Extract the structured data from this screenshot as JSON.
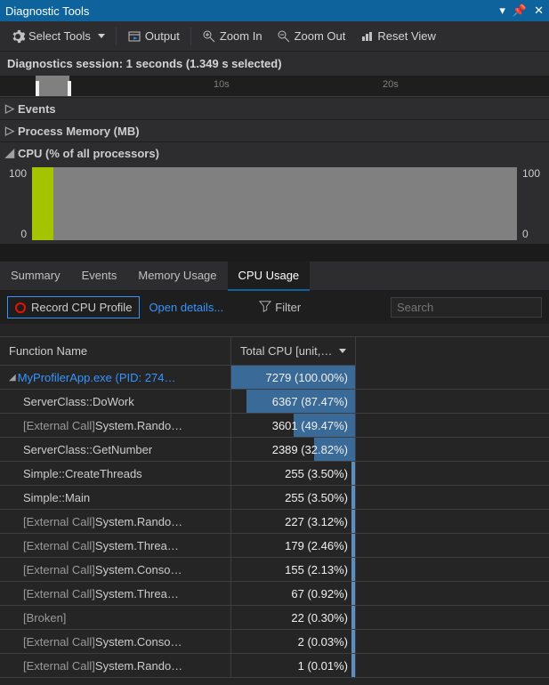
{
  "title": "Diagnostic Tools",
  "toolbar": {
    "select_tools": "Select Tools",
    "output": "Output",
    "zoom_in": "Zoom In",
    "zoom_out": "Zoom Out",
    "reset_view": "Reset View"
  },
  "session_info": "Diagnostics session: 1 seconds (1.349 s selected)",
  "timeline": {
    "ticks": [
      "10s",
      "20s"
    ]
  },
  "sections": {
    "events": "Events",
    "process_memory": "Process Memory (MB)",
    "cpu_header": "CPU (% of all processors)"
  },
  "chart_data": {
    "type": "area",
    "title": "CPU (% of all processors)",
    "xlabel": "",
    "ylabel": "",
    "ylim": [
      0,
      100
    ],
    "ylabels_left": [
      "100",
      "0"
    ],
    "ylabels_right": [
      "100",
      "0"
    ]
  },
  "tabs": [
    "Summary",
    "Events",
    "Memory Usage",
    "CPU Usage"
  ],
  "active_tab": 3,
  "cpu_toolbar": {
    "record": "Record CPU Profile",
    "open_details": "Open details...",
    "filter": "Filter",
    "search_placeholder": "Search"
  },
  "columns": {
    "fn": "Function Name",
    "cpu": "Total CPU [unit,…"
  },
  "rows": [
    {
      "name": "MyProfilerApp.exe (PID: 274…",
      "depth": 0,
      "link": true,
      "expander": true,
      "value": 7279,
      "pct": 100.0,
      "bar": 100
    },
    {
      "name": "ServerClass::DoWork",
      "depth": 1,
      "value": 6367,
      "pct": 87.47,
      "bar": 87.47
    },
    {
      "name": "[External Call] System.Rando…",
      "depth": 1,
      "dimprefix": "[External Call] ",
      "rest": "System.Rando…",
      "value": 3601,
      "pct": 49.47,
      "bar": 49.47
    },
    {
      "name": "ServerClass::GetNumber",
      "depth": 1,
      "value": 2389,
      "pct": 32.82,
      "bar": 32.82
    },
    {
      "name": "Simple::CreateThreads",
      "depth": 1,
      "value": 255,
      "pct": 3.5,
      "bar": 3.5
    },
    {
      "name": "Simple::Main",
      "depth": 1,
      "value": 255,
      "pct": 3.5,
      "bar": 3.5
    },
    {
      "name": "[External Call] System.Rando…",
      "depth": 1,
      "dimprefix": "[External Call] ",
      "rest": "System.Rando…",
      "value": 227,
      "pct": 3.12,
      "bar": 3.12
    },
    {
      "name": "[External Call] System.Threa…",
      "depth": 1,
      "dimprefix": "[External Call] ",
      "rest": "System.Threa…",
      "value": 179,
      "pct": 2.46,
      "bar": 2.46
    },
    {
      "name": "[External Call] System.Conso…",
      "depth": 1,
      "dimprefix": "[External Call] ",
      "rest": "System.Conso…",
      "value": 155,
      "pct": 2.13,
      "bar": 2.13
    },
    {
      "name": "[External Call] System.Threa…",
      "depth": 1,
      "dimprefix": "[External Call] ",
      "rest": "System.Threa…",
      "value": 67,
      "pct": 0.92,
      "bar": 0.92
    },
    {
      "name": "[Broken]",
      "depth": 1,
      "dimprefix": "[Broken]",
      "rest": "",
      "value": 22,
      "pct": 0.3,
      "bar": 0.3
    },
    {
      "name": "[External Call] System.Conso…",
      "depth": 1,
      "dimprefix": "[External Call] ",
      "rest": "System.Conso…",
      "value": 2,
      "pct": 0.03,
      "bar": 0.03
    },
    {
      "name": "[External Call] System.Rando…",
      "depth": 1,
      "dimprefix": "[External Call] ",
      "rest": "System.Rando…",
      "value": 1,
      "pct": 0.01,
      "bar": 0.01
    }
  ]
}
